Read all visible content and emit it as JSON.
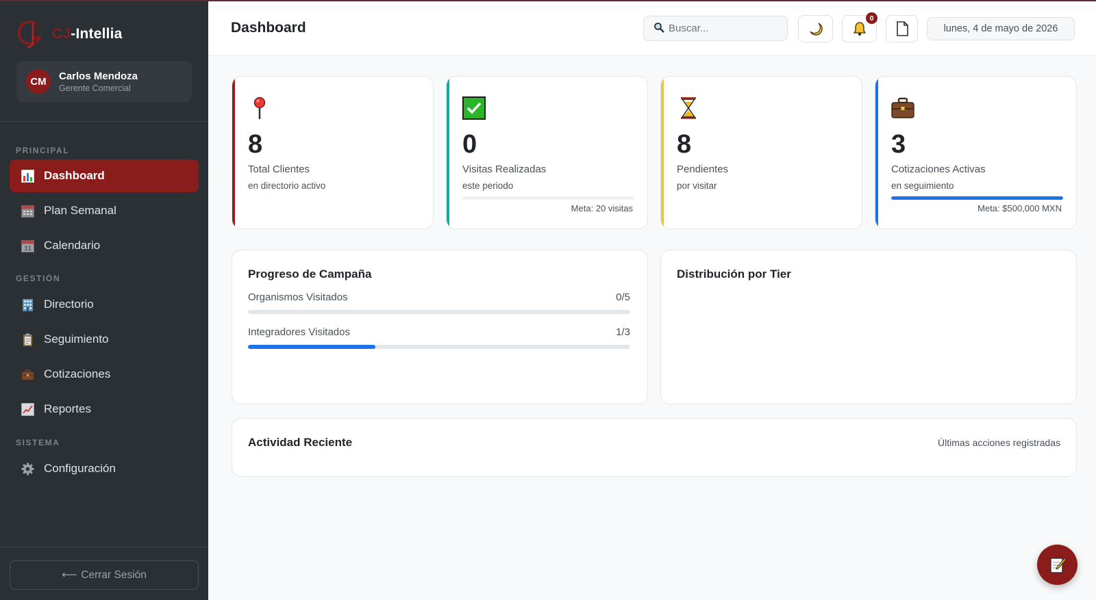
{
  "app": {
    "brand_prefix": "CJ",
    "brand_suffix": "-Intellia"
  },
  "user": {
    "initials": "CM",
    "name": "Carlos Mendoza",
    "role": "Gerente Comercial"
  },
  "sidebar": {
    "sections": [
      {
        "label": "PRINCIPAL"
      },
      {
        "label": "GESTIÓN"
      },
      {
        "label": "SISTEMA"
      }
    ],
    "items": [
      {
        "label": "Dashboard",
        "icon": "bar-chart-icon",
        "active": true
      },
      {
        "label": "Plan Semanal",
        "icon": "calendar-grid-icon"
      },
      {
        "label": "Calendario",
        "icon": "calendar-31-icon"
      },
      {
        "label": "Directorio",
        "icon": "building-icon"
      },
      {
        "label": "Seguimiento",
        "icon": "clipboard-icon"
      },
      {
        "label": "Cotizaciones",
        "icon": "briefcase-icon"
      },
      {
        "label": "Reportes",
        "icon": "line-chart-icon"
      },
      {
        "label": "Configuración",
        "icon": "gear-icon"
      }
    ],
    "logout_label": "Cerrar Sesión"
  },
  "header": {
    "title": "Dashboard",
    "search_placeholder": "Buscar...",
    "notifications_count": "0",
    "date": "lunes, 4 de mayo de 2026"
  },
  "stats": [
    {
      "value": "8",
      "label": "Total Clientes",
      "sub": "en directorio activo",
      "accent": "#9b1c1c",
      "icon": "pushpin-icon"
    },
    {
      "value": "0",
      "label": "Visitas Realizadas",
      "sub": "este periodo",
      "meta": "Meta: 20 visitas",
      "progress": 0,
      "accent": "#1aa89a",
      "icon": "check-box-icon"
    },
    {
      "value": "8",
      "label": "Pendientes",
      "sub": "por visitar",
      "accent": "#f0c24b",
      "icon": "hourglass-icon"
    },
    {
      "value": "3",
      "label": "Cotizaciones Activas",
      "sub": "en seguimiento",
      "meta": "Meta: $500,000 MXN",
      "progress": 1.0,
      "accent": "#1a73e8",
      "icon": "briefcase-icon"
    }
  ],
  "campaign": {
    "title": "Progreso de Campaña",
    "rows": [
      {
        "label": "Organismos Visitados",
        "count": "0/5",
        "fraction": 0
      },
      {
        "label": "Integradores Visitados",
        "count": "1/3",
        "fraction": 0.333
      }
    ]
  },
  "tier": {
    "title": "Distribución por Tier"
  },
  "activity": {
    "title": "Actividad Reciente",
    "subtitle": "Últimas acciones registradas"
  },
  "colors": {
    "brand": "#8b1c1c",
    "sidebar_bg": "#2b3035",
    "progress_blue": "#1a73e8"
  }
}
